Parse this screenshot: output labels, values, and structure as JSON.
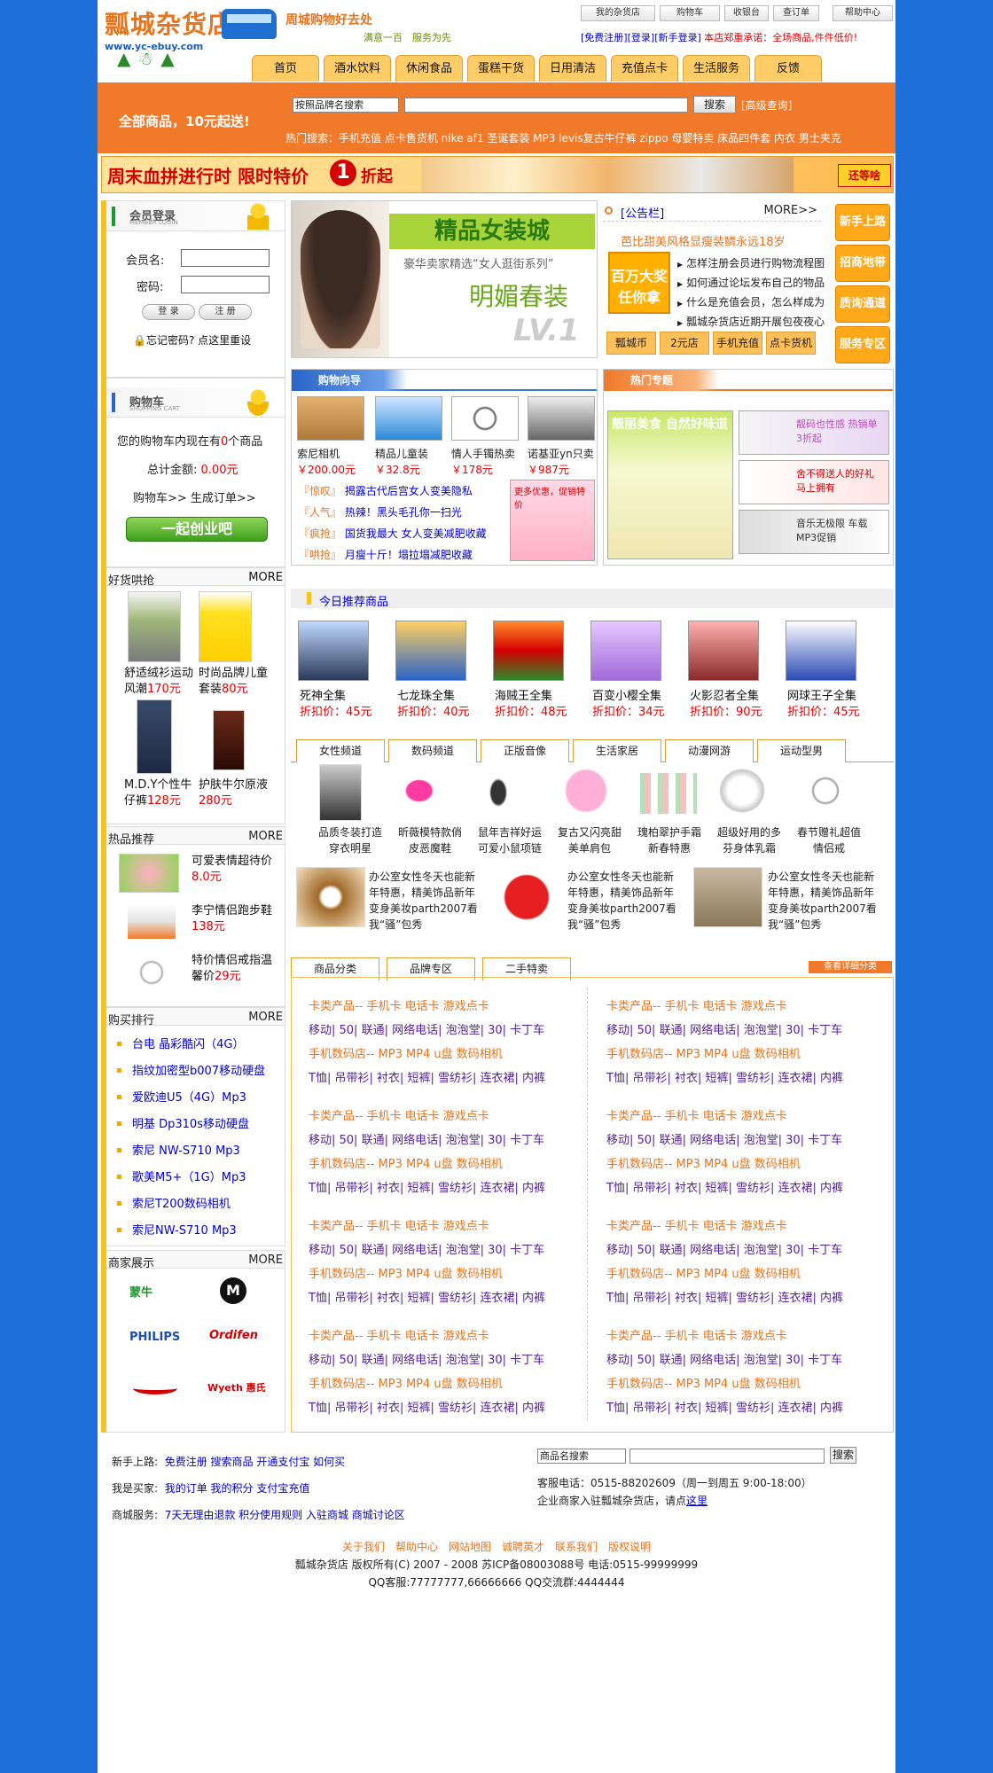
{
  "header": {
    "logo_text": "瓢城杂货店",
    "logo_url": "www.yc-ebuy.com",
    "slogan": "周城购物好去处",
    "slogan2": "满意一百　服务为先",
    "top_buttons": [
      "我的杂货店",
      "购物车",
      "收银台",
      "查订单",
      "帮助中心"
    ],
    "top_links": [
      "[免费注册]",
      "[登录]",
      "[新手登录]"
    ],
    "notice_text": "本店郑重承诺：全场商品,件件低价!"
  },
  "nav": [
    "首页",
    "酒水饮料",
    "休闲食品",
    "蛋糕干货",
    "日用清洁",
    "充值点卡",
    "生活服务",
    "反馈"
  ],
  "search": {
    "all_goods": "全部商品，10元起送!",
    "select_value": "按照品牌名搜索",
    "button": "搜索",
    "advanced": "[高级查询]",
    "hot_label": "热门搜索：",
    "hot_terms": "手机充值 点卡售货机 nike af1 圣诞套装 MP3 levis复古牛仔裤 zippo 母婴特卖 床品四件套 内衣 男士夹克"
  },
  "banner": {
    "title": "周末血拼进行时 限时特价",
    "num": "1",
    "unit": "折起",
    "end": "还等啥"
  },
  "login": {
    "title": "会员登录",
    "sub": "MEMBER LOGIN",
    "user_label": "会员名:",
    "pass_label": "密码:",
    "login_btn": "登 录",
    "reg_btn": "注 册",
    "forgot": "忘记密码?",
    "reset": "点这里重设"
  },
  "cart": {
    "title": "购物车",
    "sub": "SHOPPING CART",
    "line1a": "您的购物车内现在有",
    "count": "0",
    "line1b": "个商品",
    "total_label": "总计金额:",
    "total": "0.00元",
    "steps": "购物车>> 生成订单>>",
    "cta": "一起创业吧"
  },
  "good_goods": {
    "title": "好货哄抢",
    "more": "MORE",
    "items": [
      {
        "name": "舒适绒衫运动风潮",
        "price": "170元"
      },
      {
        "name": "时尚品牌儿童套装",
        "price": "80元"
      },
      {
        "name": "M.D.Y个性牛仔裤",
        "price": "128元"
      },
      {
        "name": "护肤牛尔原液",
        "price": "280元"
      }
    ]
  },
  "hot_rec": {
    "title": "热品推荐",
    "more": "MORE",
    "items": [
      {
        "name": "可爱表情超待价",
        "price": "8.0元"
      },
      {
        "name": "李宁情侣跑步鞋",
        "price": "138元"
      },
      {
        "name": "特价情侣戒指温馨价",
        "price": "29元"
      }
    ]
  },
  "buy_rank": {
    "title": "购买排行",
    "more": "MORE",
    "items": [
      "台电 晶彩酷闪（4G）",
      "指纹加密型b007移动硬盘",
      "爱欧迪U5（4G）Mp3",
      "明基 Dp310s移动硬盘",
      "索尼 NW-S710 Mp3",
      "歌美M5+（1G）Mp3",
      "索尼T200数码相机",
      "索尼NW-S710 Mp3"
    ]
  },
  "merchants": {
    "title": "商家展示",
    "more": "MORE",
    "items": [
      "蒙牛",
      "MOTOROLA",
      "PHILIPS",
      "Ordifen",
      "LI-NING",
      "Wyeth 惠氏"
    ]
  },
  "feature": {
    "t1": "精品女装城",
    "t2": "豪华卖家精选“女人逛街系列”",
    "t3": "明媚春装",
    "t4": "LV.1"
  },
  "notice": {
    "title": "[公告栏]",
    "more": "MORE>>",
    "headline": "芭比甜美风格显瘦装鳞永远18岁",
    "badge": "百万大奖 任你拿",
    "items": [
      "怎样注册会员进行购物流程图",
      "如何通过论坛发布自己的物品",
      "什么是充值会员，怎么样成为",
      "瓢城杂货店近期开展包夜夜心"
    ],
    "buttons": [
      "瓢城币",
      "2元店",
      "手机充值",
      "点卡货机"
    ],
    "side": [
      "新手上路",
      "招商地带",
      "质询通道",
      "服务专区"
    ]
  },
  "guide": {
    "title": "购物向导",
    "items": [
      {
        "name": "索尼相机",
        "price": "￥200.00元"
      },
      {
        "name": "精品儿童装",
        "price": "￥32.8元"
      },
      {
        "name": "情人手镯热卖",
        "price": "￥178元"
      },
      {
        "name": "诺基亚yn只卖",
        "price": "￥987元"
      }
    ],
    "links": [
      {
        "b": "『惊叹』",
        "t": "揭露古代后宫女人变美隐私"
      },
      {
        "b": "『人气』",
        "t": "热辣！黑头毛孔你一扫光"
      },
      {
        "b": "『疯抢』",
        "t": "国货我最大 女人变美减肥收藏"
      },
      {
        "b": "『哄抢』",
        "t": "月瘦十斤！塌拉塌减肥收藏"
      }
    ],
    "promo": "更多优惠，促销特价"
  },
  "hot_topic": {
    "title": "热门专题",
    "ad1": "靓丽美食 自然好味道",
    "ad2": "靓码也性感 热销单 3折起",
    "ad3": "舍不得送人的好礼 马上拥有",
    "ad4": "音乐无极限 车载MP3促销"
  },
  "today": {
    "title": "今日推荐商品",
    "items": [
      {
        "name": "死神全集",
        "price": "折扣价：45元"
      },
      {
        "name": "七龙珠全集",
        "price": "折扣价：40元"
      },
      {
        "name": "海贼王全集",
        "price": "折扣价：48元"
      },
      {
        "name": "百变小樱全集",
        "price": "折扣价：34元"
      },
      {
        "name": "火影忍者全集",
        "price": "折扣价：90元"
      },
      {
        "name": "网球王子全集",
        "price": "折扣价：45元"
      }
    ]
  },
  "channels": {
    "tabs": [
      "女性频道",
      "数码频道",
      "正版音像",
      "生活家居",
      "动漫网游",
      "运动型男"
    ],
    "items": [
      "品质冬装打造穿衣明星",
      "昕薇模特款俏皮恶魔鞋",
      "鼠年吉祥好运可爱小鼠项链",
      "复古又闪亮甜美单肩包",
      "瑰柏翠护手霜新春特惠",
      "超级好用的多芬身体乳霜",
      "春节赠礼超值情侣戒"
    ],
    "promo": "办公室女性冬天也能新年特惠，精美饰品新年变身美妆parth2007看我“骚”包秀"
  },
  "categories": {
    "tabs": [
      "商品分类",
      "品牌专区",
      "二手特卖"
    ],
    "detail": "查看详细分类",
    "o1": "卡类产品-- 手机卡 电话卡 游戏点卡",
    "p1": "移动| 50| 联通| 网络电话| 泡泡堂| 30| 卡丁车",
    "o2": "手机数码店-- MP3 MP4 u盘 数码相机",
    "p2": "T恤| 吊带衫| 衬衣| 短裤| 雪纺衫| 连衣裙| 内裤"
  },
  "footer": {
    "rows": [
      {
        "label": "新手上路:",
        "links": "免费注册 搜索商品 开通支付宝 如何买"
      },
      {
        "label": "我是买家:",
        "links": "我的订单 我的积分 支付宝充值"
      },
      {
        "label": "商城服务:",
        "links": "7天无理由退款 积分使用规则 入驻商城 商城讨论区"
      }
    ],
    "select": "商品名搜索",
    "btn": "搜索",
    "service": "客服电话：0515-88202609（周一到周五 9:00-18:00）",
    "join": "企业商家入驻瓢城杂货店，请点",
    "here": "这里",
    "links": "关于我们　帮助中心　网站地图　诚聘英才　联系我们　版权说明",
    "copyright": "瓢城杂货店 版权所有(C) 2007 - 2008 苏ICP备08003088号 电话:0515-99999999",
    "qq": "QQ客服:77777777,66666666 QQ交流群:4444444"
  },
  "colors": {
    "accent": "#f07a2a",
    "page_bg": "#1e6fd8",
    "price": "#e60000",
    "link": "#0000cc"
  }
}
